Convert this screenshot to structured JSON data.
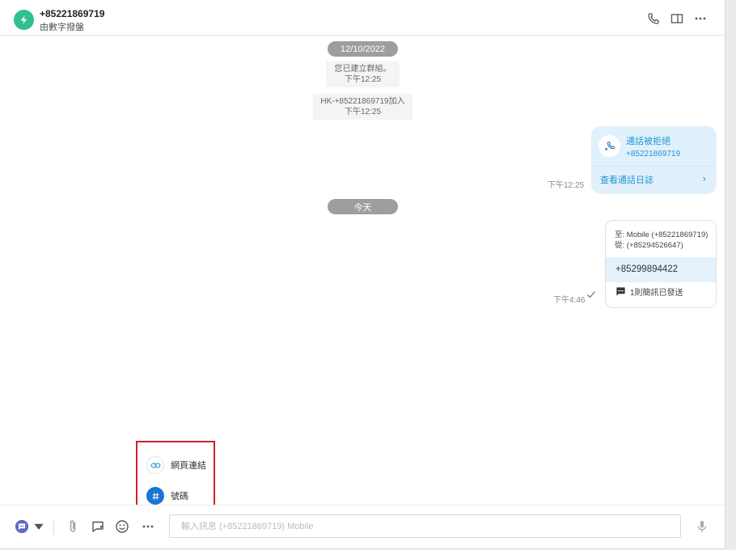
{
  "header": {
    "title": "+85221869719",
    "subtitle": "由數字撥盤",
    "avatar_color": "#2fbf91"
  },
  "chat": {
    "date_pill_1": "12/10/2022",
    "system_messages": [
      {
        "text": "您已建立群組。",
        "time": "下午12:25"
      },
      {
        "text": "HK-+85221869719加入",
        "time": "下午12:25"
      }
    ],
    "call_card": {
      "title": "通話被拒絕",
      "number": "+85221869719",
      "link": "查看通話日誌",
      "timestamp": "下午12:25"
    },
    "date_pill_2": "今天",
    "sms_card": {
      "to": "至: Mobile (+85221869719)",
      "from": "從: (+85294526647)",
      "number": "+85299894422",
      "status": "1則簡訊已發送",
      "timestamp": "下午4:46"
    }
  },
  "popup_menu": {
    "items": [
      {
        "label": "網頁連結",
        "icon": "link-icon"
      },
      {
        "label": "號碼",
        "icon": "hash-icon"
      }
    ],
    "highlight_color": "#d32027"
  },
  "composer": {
    "placeholder": "輸入訊息 (+85221869719) Mobile",
    "value": ""
  },
  "colors": {
    "accent": "#2196d3",
    "brand_blue": "#1976d2",
    "channel_purple": "#5c6bc0"
  }
}
